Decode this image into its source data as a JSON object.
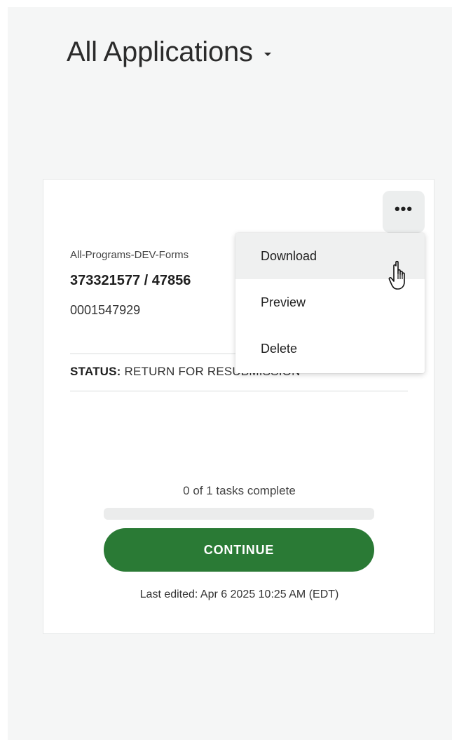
{
  "header": {
    "title": "All Applications",
    "dropdown_icon": "caret-down-icon"
  },
  "card": {
    "more_icon": "more-horizontal-icon",
    "more_label": "•••",
    "program_name": "All-Programs-DEV-Forms",
    "application_ids": "373321577 / 47856",
    "application_number": "0001547929",
    "status_label": "STATUS:",
    "status_value": "RETURN FOR RESUBMISSION",
    "tasks_text": "0 of 1 tasks complete",
    "progress_fraction": 0,
    "continue_label": "CONTINUE",
    "last_edited": "Last edited: Apr 6 2025 10:25 AM (EDT)"
  },
  "menu": {
    "items": [
      {
        "label": "Download",
        "hovered": true
      },
      {
        "label": "Preview",
        "hovered": false
      },
      {
        "label": "Delete",
        "hovered": false
      }
    ]
  },
  "colors": {
    "primary_green": "#2a7a35",
    "panel_bg": "#f5f6f6",
    "button_gray": "#eceeee"
  },
  "cursor_icon": "hand-pointer-icon"
}
